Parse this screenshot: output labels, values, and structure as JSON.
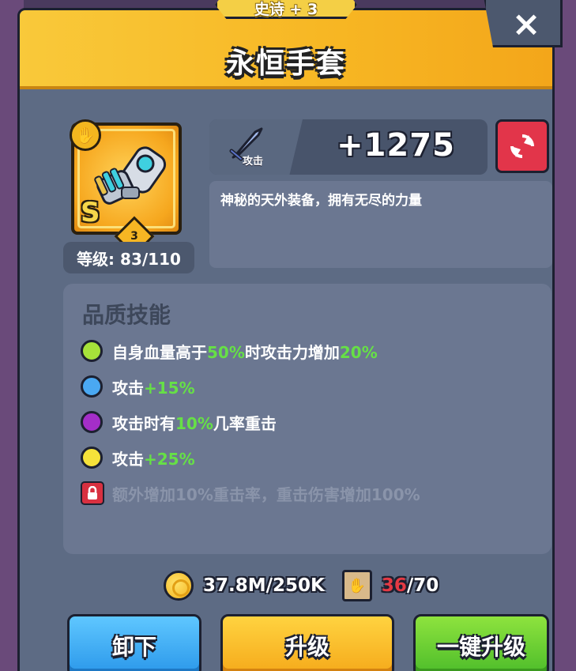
{
  "header": {
    "rarity_tab": "史诗 + 3",
    "title": "永恒手套",
    "close_icon": "×"
  },
  "item": {
    "icon": "gauntlet-icon",
    "type_badge_icon": "hand-icon",
    "grade": "S",
    "stars": "3",
    "level_text": "等级: 83/110"
  },
  "stat": {
    "icon": "sword-icon",
    "label": "攻击",
    "value": "+1275"
  },
  "refresh_icon": "refresh-icon",
  "description": "神秘的天外装备，拥有无尽的力量",
  "skills": {
    "title": "品质技能",
    "items": [
      {
        "color": "#a6e23a",
        "parts": [
          "自身血量高于",
          "50%",
          "时攻击力增加",
          "20%"
        ]
      },
      {
        "color": "#4aa8f2",
        "parts": [
          "攻击",
          "+15%"
        ]
      },
      {
        "color": "#a42ec8",
        "parts": [
          "攻击时有",
          "10%",
          "几率重击"
        ]
      },
      {
        "color": "#f6e23a",
        "parts": [
          "攻击",
          "+25%"
        ]
      }
    ],
    "locked_text": "额外增加10%重击率，重击伤害增加100%"
  },
  "resources": {
    "coin_text": "37.8M/250K",
    "scroll_have": "36",
    "scroll_need": "/70"
  },
  "buttons": {
    "unequip": "卸下",
    "upgrade": "升级",
    "one_click_upgrade": "一键升级"
  },
  "colors": {
    "header_yellow": "#f7b623",
    "panel_gray": "#5d6b84",
    "refresh_red": "#e2354a",
    "highlight_green": "#66e046",
    "need_red": "#e53a44"
  }
}
